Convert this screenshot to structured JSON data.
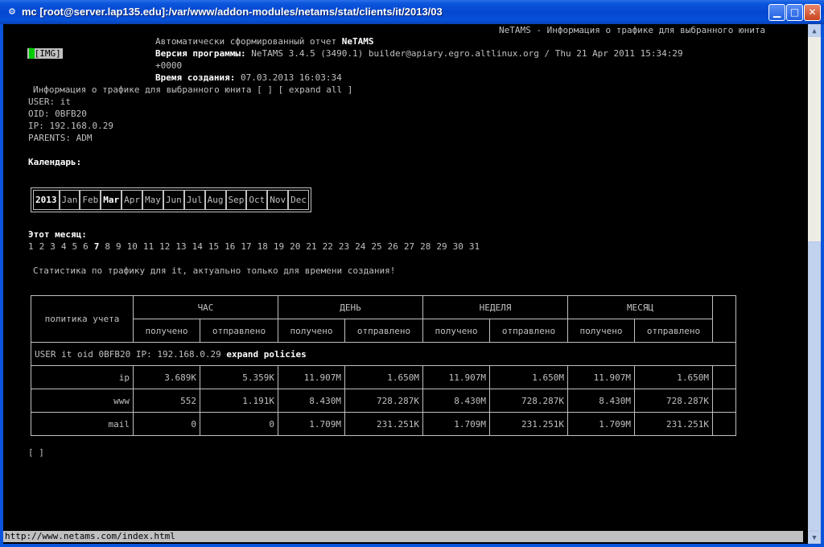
{
  "window": {
    "title": "mc [root@server.lap135.edu]:/var/www/addon-modules/netams/stat/clients/it/2013/03"
  },
  "page": {
    "header_right": "NeTAMS - Информация о трафике для выбранного юнита",
    "img_label": "[IMG]",
    "report_auto": "Автоматически сформированный отчет",
    "report_name": "NeTAMS",
    "version_label": "Версия программы:",
    "version_value": "NeTAMS 3.4.5 (3490.1) builder@apiary.egro.altlinux.org / Thu 21 Apr 2011 15:34:29",
    "version_tz": "+0000",
    "created_label": "Время создания:",
    "created_value": "07.03.2013 16:03:34",
    "info_title": "Информация о трафике для выбранного юнита [ ] [ expand all ]",
    "user": "USER: it",
    "oid": "OID: 0BFB20",
    "ip": "IP: 192.168.0.29",
    "parents": "PARENTS: ADM",
    "calendar_label": "Календарь:",
    "month_label": "Этот месяц:",
    "stats_note": "Статистика по трафику для it, актуально только для времени создания!",
    "footer_brackets": "[ ]"
  },
  "calendar": {
    "year": "2013",
    "months": [
      "Jan",
      "Feb",
      "Mar",
      "Apr",
      "May",
      "Jun",
      "Jul",
      "Aug",
      "Sep",
      "Oct",
      "Nov",
      "Dec"
    ],
    "current_month": "Mar"
  },
  "days": [
    "1",
    "2",
    "3",
    "4",
    "5",
    "6",
    "7",
    "8",
    "9",
    "10",
    "11",
    "12",
    "13",
    "14",
    "15",
    "16",
    "17",
    "18",
    "19",
    "20",
    "21",
    "22",
    "23",
    "24",
    "25",
    "26",
    "27",
    "28",
    "29",
    "30",
    "31"
  ],
  "current_day": "7",
  "table": {
    "policy_header": "политика учета",
    "periods": [
      "ЧАС",
      "ДЕНЬ",
      "НЕДЕЛЯ",
      "МЕСЯЦ"
    ],
    "sub_headers": [
      "получено",
      "отправлено"
    ],
    "user_row": "USER it oid 0BFB20 IP: 192.168.0.29",
    "expand_policies": "expand policies",
    "rows": [
      {
        "policy": "ip",
        "values": [
          "3.689K",
          "5.359K",
          "11.907M",
          "1.650M",
          "11.907M",
          "1.650M",
          "11.907M",
          "1.650M"
        ]
      },
      {
        "policy": "www",
        "values": [
          "552",
          "1.191K",
          "8.430M",
          "728.287K",
          "8.430M",
          "728.287K",
          "8.430M",
          "728.287K"
        ]
      },
      {
        "policy": "mail",
        "values": [
          "0",
          "0",
          "1.709M",
          "231.251K",
          "1.709M",
          "231.251K",
          "1.709M",
          "231.251K"
        ]
      }
    ]
  },
  "status_bar": "http://www.netams.com/index.html"
}
